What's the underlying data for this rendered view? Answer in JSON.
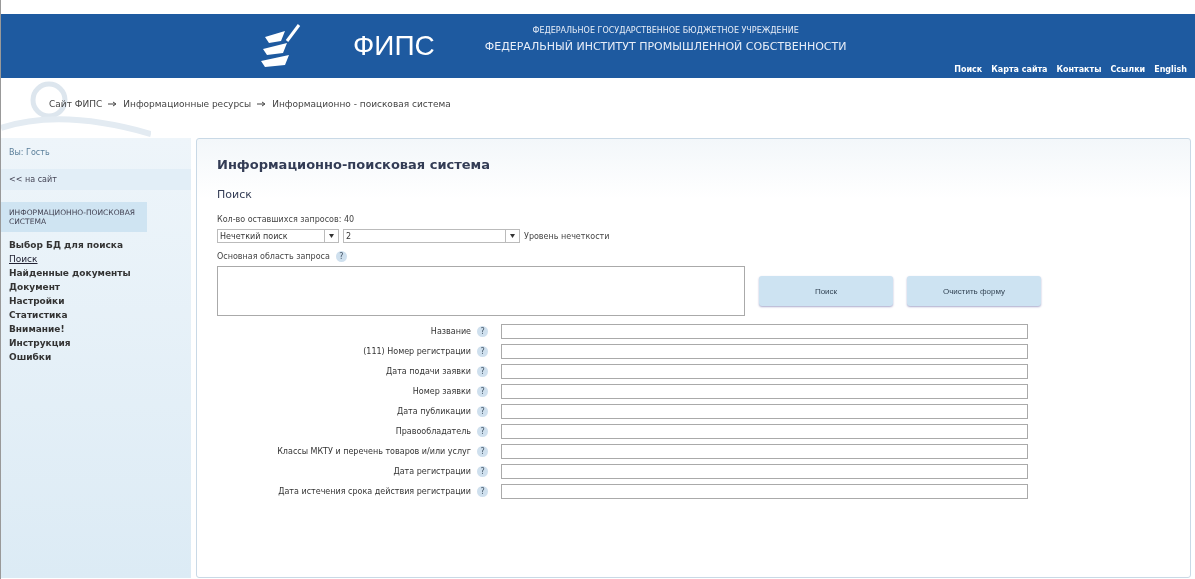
{
  "header": {
    "logo_text": "ФИПС",
    "org_line_1": "ФЕДЕРАЛЬНОЕ ГОСУДАРСТВЕННОЕ БЮДЖЕТНОЕ УЧРЕЖДЕНИЕ",
    "org_line_2": "ФЕДЕРАЛЬНЫЙ ИНСТИТУТ ПРОМЫШЛЕННОЙ СОБСТВЕННОСТИ",
    "links": [
      "Поиск",
      "Карта сайта",
      "Контакты",
      "Ссылки",
      "English"
    ]
  },
  "breadcrumb": [
    "Сайт ФИПС",
    "Информационные ресурсы",
    "Информационно - поисковая система"
  ],
  "sidebar": {
    "user": "Вы: Гость",
    "back_link": "<< на сайт",
    "section": "ИНФОРМАЦИОННО-ПОИСКОВАЯ СИСТЕМА",
    "items": [
      {
        "label": "Выбор БД для поиска",
        "selected": false
      },
      {
        "label": "Поиск",
        "selected": true
      },
      {
        "label": "Найденные документы",
        "selected": false
      },
      {
        "label": "Документ",
        "selected": false
      },
      {
        "label": "Настройки",
        "selected": false
      },
      {
        "label": "Статистика",
        "selected": false
      },
      {
        "label": "Внимание!",
        "selected": false
      },
      {
        "label": "Инструкция",
        "selected": false
      },
      {
        "label": "Ошибки",
        "selected": false
      }
    ]
  },
  "main": {
    "title": "Информационно-поисковая система",
    "subtitle": "Поиск",
    "remaining": "Кол-во оставшихся запросов: 40",
    "search_mode": "Нечеткий поиск",
    "fuzziness": "2",
    "fuzziness_label": "Уровень нечеткости",
    "query_label": "Основная область запроса",
    "help_mark": "?",
    "buttons": [
      "Поиск",
      "Очистить форму"
    ],
    "fields": [
      {
        "label": "Название"
      },
      {
        "label": "(111) Номер регистрации"
      },
      {
        "label": "Дата подачи заявки"
      },
      {
        "label": "Номер заявки"
      },
      {
        "label": "Дата публикации"
      },
      {
        "label": "Правообладатель"
      },
      {
        "label": "Классы МКТУ и перечень товаров и/или услуг"
      },
      {
        "label": "Дата регистрации"
      },
      {
        "label": "Дата истечения срока действия регистрации"
      }
    ]
  }
}
